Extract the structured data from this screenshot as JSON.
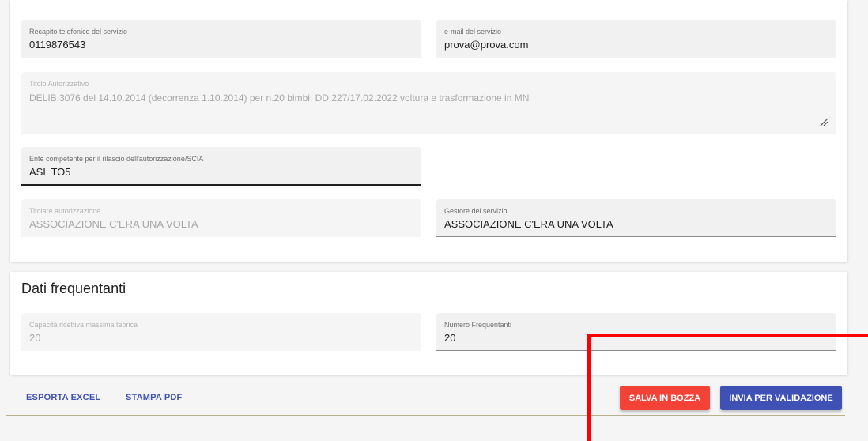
{
  "service_info": {
    "phone": {
      "label": "Recapito telefonico del servizio",
      "value": "0119876543"
    },
    "email": {
      "label": "e-mail del servizio",
      "value": "prova@prova.com"
    },
    "authorization_title": {
      "label": "Titolo Autorizzativo",
      "value": "DELIB.3076 del 14.10.2014 (decorrenza 1.10.2014) per n.20 bimbi; DD.227/17.02.2022 voltura e trasformazione in MN"
    },
    "competent_authority": {
      "label": "Ente competente per il rilascio dell'autorizzazione/SCIA",
      "value": "ASL TO5"
    },
    "authorization_holder": {
      "label": "Titolare autorizzazione",
      "value": "ASSOCIAZIONE C'ERA UNA VOLTA"
    },
    "service_manager": {
      "label": "Gestore del servizio",
      "value": "ASSOCIAZIONE C'ERA UNA VOLTA"
    }
  },
  "attendees": {
    "title": "Dati frequentanti",
    "max_capacity": {
      "label": "Capacità ricettiva massima teorica",
      "value": "20"
    },
    "attendee_count": {
      "label": "Numero Frequentanti",
      "value": "20"
    }
  },
  "actions": {
    "export_excel": "ESPORTA EXCEL",
    "print_pdf": "STAMPA PDF",
    "save_draft": "SALVA IN BOZZA",
    "send_validation": "INVIA PER VALIDAZIONE"
  },
  "colors": {
    "primary": "#3f51b5",
    "danger": "#f44336",
    "highlight": "#ff0000"
  }
}
